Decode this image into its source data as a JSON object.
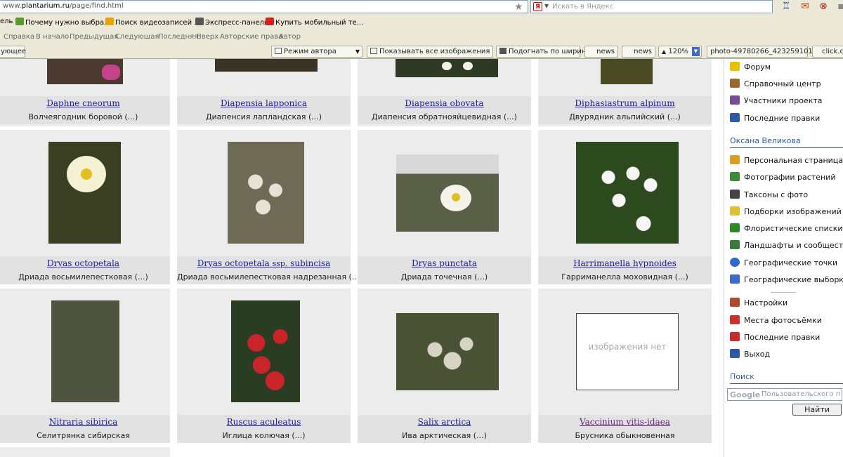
{
  "browser": {
    "url_prefix": "www.",
    "url_domain": "plantarium.ru",
    "url_path": "/page/find.html",
    "search_placeholder": "Искать в Яндекс",
    "search_engine_icon": "Я"
  },
  "bookmarks": [
    {
      "label": "ель",
      "icon_color": ""
    },
    {
      "label": "Почему нужно выбра...",
      "icon_color": "#5a9a2a"
    },
    {
      "label": "Поиск видеозаписей ...",
      "icon_color": "#e8a400"
    },
    {
      "label": "Экспресс-панель",
      "icon_color": "#555555"
    },
    {
      "label": "Купить мобильный те...",
      "icon_color": "#d42020"
    }
  ],
  "navlinks": [
    "Справка",
    "В начало",
    "Предыдущая",
    "Следующая",
    "Последняя",
    "Вверх",
    "Авторские права",
    "Автор"
  ],
  "toolbar": {
    "next_label": "ующее",
    "author_mode": "Режим автора",
    "show_all_images": "Показывать все изображения",
    "fit_width": "Подогнать по ширине",
    "news1": "news",
    "news2": "news",
    "zoom": "120%",
    "photo_id": "photo-49780266_423259101",
    "click": "click.c"
  },
  "grid": [
    {
      "latin": "Daphne cneorum",
      "russian": "Волчеягодник боровой (...)",
      "visited": false,
      "img_color": "#4a3a30"
    },
    {
      "latin": "Diapensia lapponica",
      "russian": "Диапенсия лапландская (...)",
      "visited": false,
      "img_color": "#3b3326"
    },
    {
      "latin": "Diapensia obovata",
      "russian": "Диапенсия обратнояйцевидная (...)",
      "visited": false,
      "img_color": "#2f3a24"
    },
    {
      "latin": "Diphasiastrum alpinum",
      "russian": "Двурядник альпийский (...)",
      "visited": false,
      "img_color": "#4a4a22"
    },
    {
      "latin": "Dryas octopetala",
      "russian": "Дриада восьмилепестковая (...)",
      "visited": false,
      "img_color": "#3a3f24"
    },
    {
      "latin": "Dryas octopetala",
      "latin_ssp": "ssp.",
      "latin_epithet": "subincisa",
      "russian": "Дриада восьмилепестковая надрезанная (...)",
      "visited": false,
      "img_color": "#6d6a55"
    },
    {
      "latin": "Dryas punctata",
      "russian": "Дриада точечная (...)",
      "visited": false,
      "img_color": "#5a6048"
    },
    {
      "latin": "Harrimanella hypnoides",
      "russian": "Гарриманелла моховидная (...)",
      "visited": false,
      "img_color": "#2d4a1e"
    },
    {
      "latin": "Nitraria sibirica",
      "russian": "Селитрянка сибирская",
      "visited": false,
      "img_color": "#4f5440"
    },
    {
      "latin": "Ruscus aculeatus",
      "russian": "Иглица колючая (...)",
      "visited": false,
      "img_color": "#2a3d22"
    },
    {
      "latin": "Salix arctica",
      "russian": "Ива арктическая (...)",
      "visited": false,
      "img_color": "#4a5236"
    },
    {
      "latin": "Vaccinium vitis-idaea",
      "russian": "Брусника обыкновенная",
      "visited": true,
      "no_image_text": "изображения нет"
    }
  ],
  "sidebar": {
    "top_items": [
      {
        "label": "Форум",
        "icon": "forum-icon",
        "color": "#e6c200"
      },
      {
        "label": "Справочный центр",
        "icon": "help-center-icon",
        "color": "#9a6a2a"
      },
      {
        "label": "Участники проекта",
        "icon": "members-icon",
        "color": "#7a4a9a"
      },
      {
        "label": "Последние правки",
        "icon": "recent-edits-icon",
        "color": "#2a5aaa"
      }
    ],
    "user_name": "Оксана Великова",
    "user_items": [
      {
        "label": "Персональная страница",
        "icon": "person-icon",
        "color": "#d8a020"
      },
      {
        "label": "Фотографии растений",
        "icon": "photo-icon",
        "color": "#3a8a3a"
      },
      {
        "label": "Таксоны с фото",
        "icon": "taxa-icon",
        "color": "#444444"
      },
      {
        "label": "Подборки изображений",
        "icon": "collections-icon",
        "color": "#e0c030"
      },
      {
        "label": "Флористические списки",
        "icon": "floristic-lists-icon",
        "color": "#2a8a2a"
      },
      {
        "label": "Ландшафты и сообщества",
        "icon": "landscape-icon",
        "color": "#3a7a3a"
      },
      {
        "label": "Географические точки",
        "icon": "geo-points-icon",
        "color": "#2a6acc"
      },
      {
        "label": "Географические выборки",
        "icon": "geo-selections-icon",
        "color": "#3a6acc"
      }
    ],
    "settings_items": [
      {
        "label": "Настройки",
        "icon": "settings-icon",
        "color": "#b04a2a"
      },
      {
        "label": "Места фотосъёмки",
        "icon": "photo-places-icon",
        "color": "#cc3030"
      },
      {
        "label": "Последние правки",
        "icon": "recent-edits-icon",
        "color": "#cc2a2a"
      },
      {
        "label": "Выход",
        "icon": "logout-icon",
        "color": "#2a5aaa"
      }
    ],
    "search_title": "Поиск",
    "search_logo": "Google",
    "search_placeholder": "Пользовательского по",
    "search_button": "Найти"
  }
}
